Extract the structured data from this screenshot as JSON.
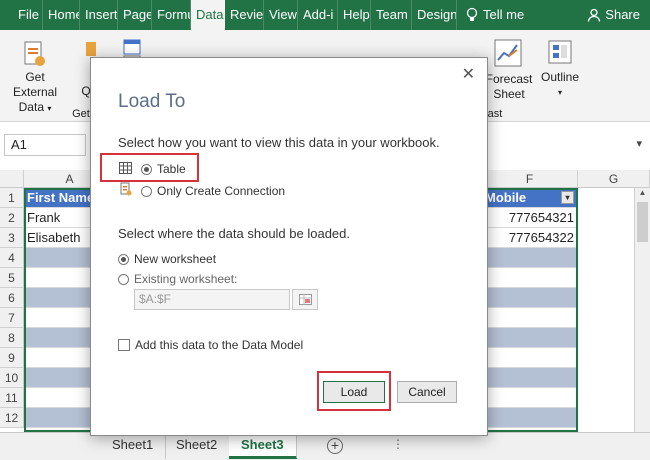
{
  "ribbon_tabs": [
    "File",
    "Home",
    "Insert",
    "Page",
    "Formu",
    "Data",
    "Revie",
    "View",
    "Add-i",
    "Help",
    "Team",
    "Design"
  ],
  "ribbon_active": "Data",
  "tell_me": "Tell me",
  "share": "Share",
  "ribbon": {
    "get_external_1": "Get External",
    "get_external_2": "Data",
    "partial_q": "Q",
    "partial_get": "Get",
    "forecast_1": "Forecast",
    "forecast_2": "Sheet",
    "forecast_group": "ast",
    "outline": "Outline"
  },
  "namebox": "A1",
  "columns": [
    "A",
    "F",
    "G"
  ],
  "rows": [
    "1",
    "2",
    "3",
    "4",
    "5",
    "6",
    "7",
    "8",
    "9",
    "10",
    "11",
    "12"
  ],
  "table": {
    "header_first": "First Name",
    "header_mobile": "Mobile",
    "row2_name": "Frank",
    "row2_mobile": "777654321",
    "row3_name": "Elisabeth",
    "row3_mobile": "777654322"
  },
  "sheets": [
    "Sheet1",
    "Sheet2",
    "Sheet3"
  ],
  "active_sheet": "Sheet3",
  "dialog": {
    "title": "Load To",
    "prompt_view": "Select how you want to view this data in your workbook.",
    "opt_table": "Table",
    "opt_connection": "Only Create Connection",
    "prompt_where": "Select where the data should be loaded.",
    "opt_new": "New worksheet",
    "opt_existing": "Existing worksheet:",
    "range_value": "$A:$F",
    "datamodel": "Add this data to the Data Model",
    "load": "Load",
    "cancel": "Cancel"
  },
  "colors": {
    "excel_green": "#217346",
    "table_header": "#4472c4",
    "highlight_red": "#d7313b"
  }
}
